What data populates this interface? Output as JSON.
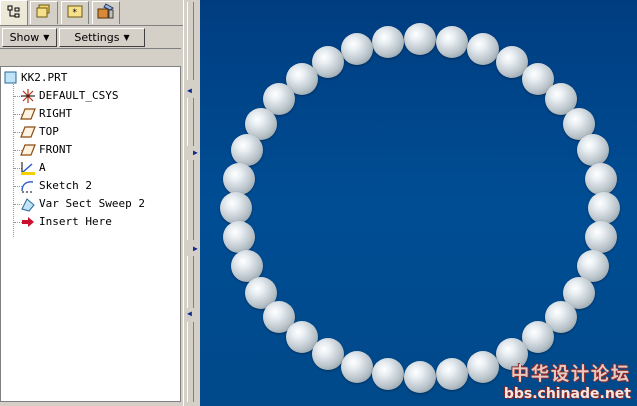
{
  "toolbar": {
    "tabs": [
      {
        "name": "model-tree-tab-icon",
        "active": true
      },
      {
        "name": "folder-browser-tab-icon",
        "active": false
      },
      {
        "name": "favorites-tab-icon",
        "active": false
      },
      {
        "name": "connections-tab-icon",
        "active": false
      }
    ],
    "show_label": "Show",
    "settings_label": "Settings"
  },
  "tree": {
    "root": {
      "label": "KK2.PRT",
      "icon": "part-icon"
    },
    "items": [
      {
        "label": "DEFAULT_CSYS",
        "icon": "csys-icon"
      },
      {
        "label": "RIGHT",
        "icon": "datum-plane-icon"
      },
      {
        "label": "TOP",
        "icon": "datum-plane-icon"
      },
      {
        "label": "FRONT",
        "icon": "datum-plane-icon"
      },
      {
        "label": "A",
        "icon": "datum-axis-icon"
      },
      {
        "label": "Sketch 2",
        "icon": "sketch-icon"
      },
      {
        "label": "Var Sect Sweep 2",
        "icon": "sweep-icon"
      },
      {
        "label": "Insert Here",
        "icon": "insert-arrow-icon"
      }
    ]
  },
  "viewport": {
    "background_top": "#003d80",
    "background_bottom": "#00498a",
    "bead_count": 36,
    "bead_color": "#c0cad0"
  },
  "watermark": {
    "line1": "中华设计论坛",
    "line2": "bbs.chinade.net"
  }
}
